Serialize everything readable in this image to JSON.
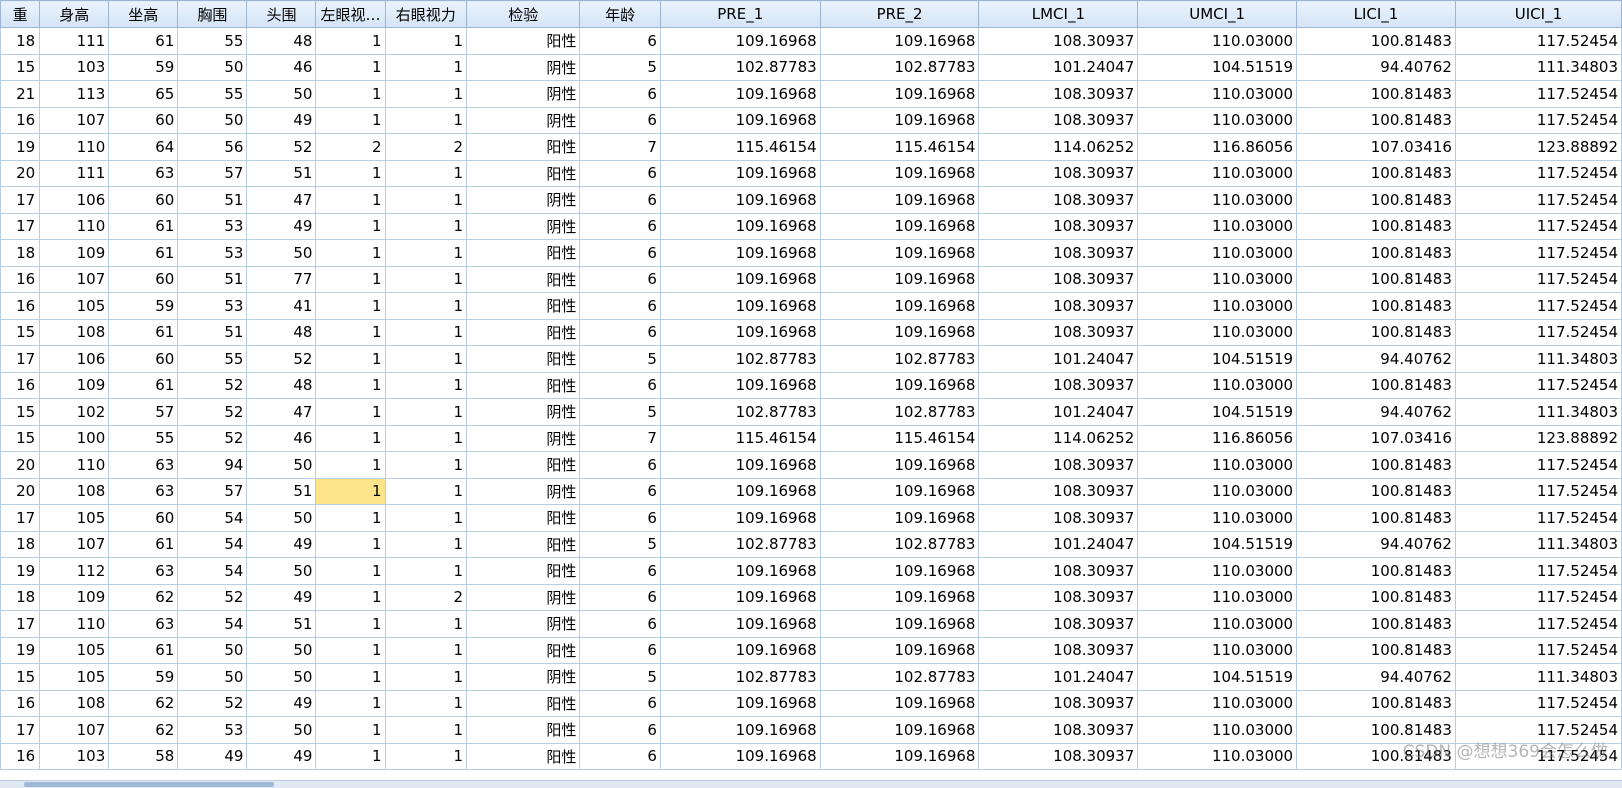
{
  "columns": [
    "重",
    "身高",
    "坐高",
    "胸围",
    "头围",
    "左眼视…",
    "右眼视力",
    "检验",
    "年龄",
    "PRE_1",
    "PRE_2",
    "LMCI_1",
    "UMCI_1",
    "LICI_1",
    "UICI_1"
  ],
  "rows": [
    [
      "18",
      "111",
      "61",
      "55",
      "48",
      "1",
      "1",
      "阳性",
      "6",
      "109.16968",
      "109.16968",
      "108.30937",
      "110.03000",
      "100.81483",
      "117.52454"
    ],
    [
      "15",
      "103",
      "59",
      "50",
      "46",
      "1",
      "1",
      "阴性",
      "5",
      "102.87783",
      "102.87783",
      "101.24047",
      "104.51519",
      "94.40762",
      "111.34803"
    ],
    [
      "21",
      "113",
      "65",
      "55",
      "50",
      "1",
      "1",
      "阴性",
      "6",
      "109.16968",
      "109.16968",
      "108.30937",
      "110.03000",
      "100.81483",
      "117.52454"
    ],
    [
      "16",
      "107",
      "60",
      "50",
      "49",
      "1",
      "1",
      "阴性",
      "6",
      "109.16968",
      "109.16968",
      "108.30937",
      "110.03000",
      "100.81483",
      "117.52454"
    ],
    [
      "19",
      "110",
      "64",
      "56",
      "52",
      "2",
      "2",
      "阳性",
      "7",
      "115.46154",
      "115.46154",
      "114.06252",
      "116.86056",
      "107.03416",
      "123.88892"
    ],
    [
      "20",
      "111",
      "63",
      "57",
      "51",
      "1",
      "1",
      "阳性",
      "6",
      "109.16968",
      "109.16968",
      "108.30937",
      "110.03000",
      "100.81483",
      "117.52454"
    ],
    [
      "17",
      "106",
      "60",
      "51",
      "47",
      "1",
      "1",
      "阴性",
      "6",
      "109.16968",
      "109.16968",
      "108.30937",
      "110.03000",
      "100.81483",
      "117.52454"
    ],
    [
      "17",
      "110",
      "61",
      "53",
      "49",
      "1",
      "1",
      "阴性",
      "6",
      "109.16968",
      "109.16968",
      "108.30937",
      "110.03000",
      "100.81483",
      "117.52454"
    ],
    [
      "18",
      "109",
      "61",
      "53",
      "50",
      "1",
      "1",
      "阳性",
      "6",
      "109.16968",
      "109.16968",
      "108.30937",
      "110.03000",
      "100.81483",
      "117.52454"
    ],
    [
      "16",
      "107",
      "60",
      "51",
      "77",
      "1",
      "1",
      "阳性",
      "6",
      "109.16968",
      "109.16968",
      "108.30937",
      "110.03000",
      "100.81483",
      "117.52454"
    ],
    [
      "16",
      "105",
      "59",
      "53",
      "41",
      "1",
      "1",
      "阳性",
      "6",
      "109.16968",
      "109.16968",
      "108.30937",
      "110.03000",
      "100.81483",
      "117.52454"
    ],
    [
      "15",
      "108",
      "61",
      "51",
      "48",
      "1",
      "1",
      "阳性",
      "6",
      "109.16968",
      "109.16968",
      "108.30937",
      "110.03000",
      "100.81483",
      "117.52454"
    ],
    [
      "17",
      "106",
      "60",
      "55",
      "52",
      "1",
      "1",
      "阳性",
      "5",
      "102.87783",
      "102.87783",
      "101.24047",
      "104.51519",
      "94.40762",
      "111.34803"
    ],
    [
      "16",
      "109",
      "61",
      "52",
      "48",
      "1",
      "1",
      "阳性",
      "6",
      "109.16968",
      "109.16968",
      "108.30937",
      "110.03000",
      "100.81483",
      "117.52454"
    ],
    [
      "15",
      "102",
      "57",
      "52",
      "47",
      "1",
      "1",
      "阴性",
      "5",
      "102.87783",
      "102.87783",
      "101.24047",
      "104.51519",
      "94.40762",
      "111.34803"
    ],
    [
      "15",
      "100",
      "55",
      "52",
      "46",
      "1",
      "1",
      "阴性",
      "7",
      "115.46154",
      "115.46154",
      "114.06252",
      "116.86056",
      "107.03416",
      "123.88892"
    ],
    [
      "20",
      "110",
      "63",
      "94",
      "50",
      "1",
      "1",
      "阳性",
      "6",
      "109.16968",
      "109.16968",
      "108.30937",
      "110.03000",
      "100.81483",
      "117.52454"
    ],
    [
      "20",
      "108",
      "63",
      "57",
      "51",
      "1",
      "1",
      "阴性",
      "6",
      "109.16968",
      "109.16968",
      "108.30937",
      "110.03000",
      "100.81483",
      "117.52454"
    ],
    [
      "17",
      "105",
      "60",
      "54",
      "50",
      "1",
      "1",
      "阳性",
      "6",
      "109.16968",
      "109.16968",
      "108.30937",
      "110.03000",
      "100.81483",
      "117.52454"
    ],
    [
      "18",
      "107",
      "61",
      "54",
      "49",
      "1",
      "1",
      "阳性",
      "5",
      "102.87783",
      "102.87783",
      "101.24047",
      "104.51519",
      "94.40762",
      "111.34803"
    ],
    [
      "19",
      "112",
      "63",
      "54",
      "50",
      "1",
      "1",
      "阳性",
      "6",
      "109.16968",
      "109.16968",
      "108.30937",
      "110.03000",
      "100.81483",
      "117.52454"
    ],
    [
      "18",
      "109",
      "62",
      "52",
      "49",
      "1",
      "2",
      "阴性",
      "6",
      "109.16968",
      "109.16968",
      "108.30937",
      "110.03000",
      "100.81483",
      "117.52454"
    ],
    [
      "17",
      "110",
      "63",
      "54",
      "51",
      "1",
      "1",
      "阴性",
      "6",
      "109.16968",
      "109.16968",
      "108.30937",
      "110.03000",
      "100.81483",
      "117.52454"
    ],
    [
      "19",
      "105",
      "61",
      "50",
      "50",
      "1",
      "1",
      "阳性",
      "6",
      "109.16968",
      "109.16968",
      "108.30937",
      "110.03000",
      "100.81483",
      "117.52454"
    ],
    [
      "15",
      "105",
      "59",
      "50",
      "50",
      "1",
      "1",
      "阴性",
      "5",
      "102.87783",
      "102.87783",
      "101.24047",
      "104.51519",
      "94.40762",
      "111.34803"
    ],
    [
      "16",
      "108",
      "62",
      "52",
      "49",
      "1",
      "1",
      "阳性",
      "6",
      "109.16968",
      "109.16968",
      "108.30937",
      "110.03000",
      "100.81483",
      "117.52454"
    ],
    [
      "17",
      "107",
      "62",
      "53",
      "50",
      "1",
      "1",
      "阳性",
      "6",
      "109.16968",
      "109.16968",
      "108.30937",
      "110.03000",
      "100.81483",
      "117.52454"
    ],
    [
      "16",
      "103",
      "58",
      "49",
      "49",
      "1",
      "1",
      "阳性",
      "6",
      "109.16968",
      "109.16968",
      "108.30937",
      "110.03000",
      "100.81483",
      "117.52454"
    ]
  ],
  "selected_cell": {
    "row": 17,
    "col": 5
  },
  "selection_color": "#fde38a",
  "watermark": "CSDN @想想369会怎么做"
}
